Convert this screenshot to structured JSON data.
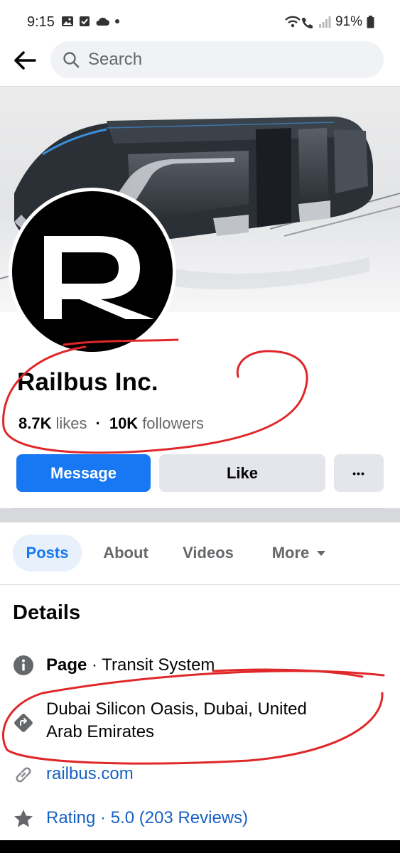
{
  "status_bar": {
    "time": "9:15",
    "battery": "91%",
    "left_icons": [
      "gallery-icon",
      "checkbox-icon",
      "cloud-icon",
      "dot-icon"
    ],
    "right_icons": [
      "wifi-calling-icon",
      "signal-icon",
      "battery-icon"
    ]
  },
  "header": {
    "search_placeholder": "Search"
  },
  "page": {
    "name": "Railbus Inc.",
    "likes_count": "8.7K",
    "likes_label": "likes",
    "separator": "·",
    "followers_count": "10K",
    "followers_label": "followers",
    "logo_letter": "R"
  },
  "actions": {
    "message": "Message",
    "like": "Like",
    "more": "•••"
  },
  "tabs": {
    "posts": "Posts",
    "about": "About",
    "videos": "Videos",
    "more": "More"
  },
  "details": {
    "title": "Details",
    "page_label": "Page",
    "category": " · Transit System",
    "address_line1": "Dubai Silicon Oasis, Dubai, United",
    "address_line2": "Arab Emirates",
    "website": "railbus.com",
    "rating": "Rating · 5.0 (203 Reviews)"
  },
  "colors": {
    "brand_blue": "#1877f2",
    "annotation_red": "#e0272a"
  }
}
